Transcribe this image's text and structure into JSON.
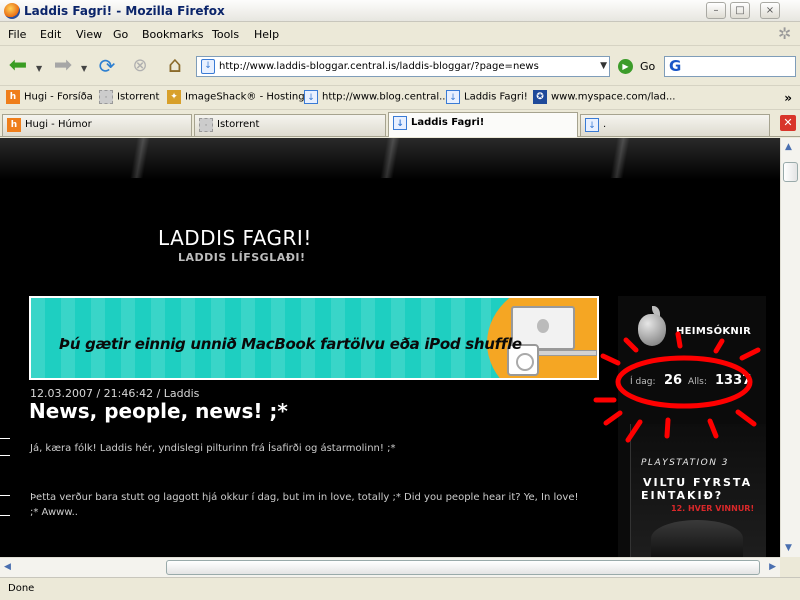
{
  "window": {
    "title": "Laddis Fagri! - Mozilla Firefox",
    "controls": {
      "minimize": "–",
      "maximize": "□",
      "close": "×"
    }
  },
  "menu": [
    "File",
    "Edit",
    "View",
    "Go",
    "Bookmarks",
    "Tools",
    "Help"
  ],
  "navbar": {
    "url": "http://www.laddis-bloggar.central.is/laddis-bloggar/?page=news",
    "go_label": "Go",
    "search_placeholder": ""
  },
  "bookmarks": [
    {
      "label": "Hugi - Forsíða",
      "icon": "hugi-icon"
    },
    {
      "label": "Istorrent",
      "icon": "istorrent-icon"
    },
    {
      "label": "ImageShack® - Hosting",
      "icon": "imageshack-icon"
    },
    {
      "label": "http://www.blog.central...",
      "icon": "blog-icon"
    },
    {
      "label": "Laddis Fagri!",
      "icon": "blog-icon"
    },
    {
      "label": "www.myspace.com/lad...",
      "icon": "myspace-icon"
    }
  ],
  "bookmarks_more": "»",
  "tabs": [
    {
      "label": "Hugi - Húmor",
      "active": false
    },
    {
      "label": "Istorrent",
      "active": false
    },
    {
      "label": "Laddis Fagri!",
      "active": true
    },
    {
      "label": ".",
      "active": false
    }
  ],
  "site": {
    "title": "LADDIS FAGRI!",
    "subtitle": "LADDIS LÍFSGLAÐI!",
    "banner_text": "Þú gætir einnig unnið MacBook fartölvu eða iPod shuffle"
  },
  "post": {
    "meta": "12.03.2007 / 21:46:42 / Laddis",
    "title": "News, people, news! ;*",
    "paragraph1": "Já, kæra fólk! Laddis hér, yndislegi pilturinn frá Ísafirði og ástarmolinn! ;*",
    "paragraph2": "Þetta verður bara stutt og laggott hjá okkur í dag, but im in love, totally ;* Did you people hear it? Ye, In love! ;* Awww.."
  },
  "sidebar": {
    "visitors_heading": "HEIMSÓKNIR",
    "today_label": "Í dag:",
    "today_value": "26",
    "total_label": "Alls:",
    "total_value": "1337",
    "ad": {
      "logo": "PLAYSTATION 3",
      "line1": "VILTU FYRSTA",
      "line2": "EINTAKIÐ?",
      "line3": "12. HVER VINNUR!"
    }
  },
  "status": "Done",
  "colors": {
    "annotation_red": "#ff0000",
    "banner_cyan": "#1ecfc1",
    "banner_orange": "#f5a623"
  }
}
